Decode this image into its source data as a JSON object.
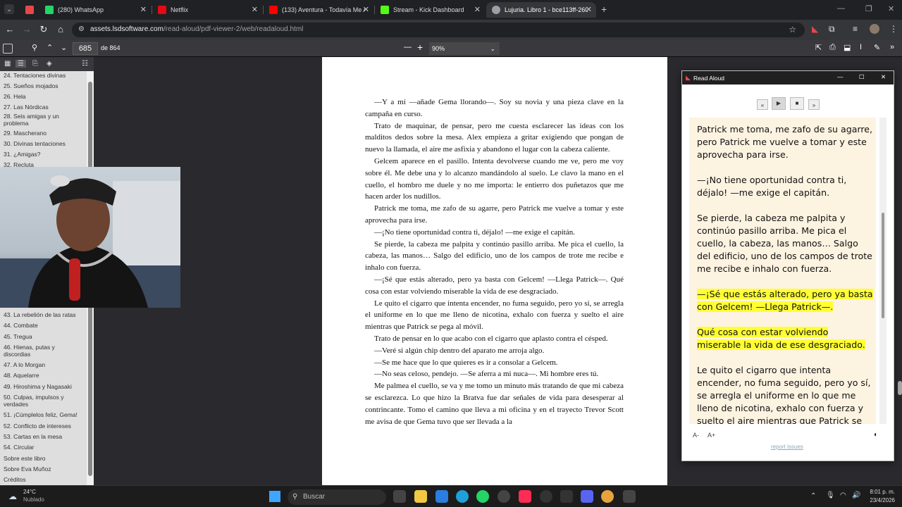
{
  "tabs": [
    {
      "title": "(280) WhatsApp",
      "color": "#25d366"
    },
    {
      "title": "Netflix",
      "color": "#e50914"
    },
    {
      "title": "(133) Aventura - Todavía Me A…",
      "color": "#ff0000"
    },
    {
      "title": "Stream - Kick Dashboard",
      "color": "#53fc18"
    },
    {
      "title": "Lujuria. Libro 1 - bce113ff-2606…",
      "color": "#9aa0a6"
    }
  ],
  "address": {
    "domain": "assets.lsdsoftware.com",
    "path": "/read-aloud/pdf-viewer-2/web/readaloud.html"
  },
  "pdf_toolbar": {
    "page": "685",
    "of": "de 864",
    "zoom": "90%"
  },
  "outline": [
    "24. Tentaciones divinas",
    "25. Sueños mojados",
    "26. Hela",
    "27. Las Nórdicas",
    "28. Seis amigas y un",
    "problema",
    "29. Mascherano",
    "30. Divinas tentaciones",
    "31. ¿Amigas?",
    "32. Recluta",
    "43. La rebelión de las ratas",
    "44. Combate",
    "45. Tregua",
    "46. Hienas, putas y",
    "discordias",
    "47. A lo Morgan",
    "48. Aquelarre",
    "49. Hiroshima y Nagasaki",
    "50. Culpas, impulsos y",
    "verdades",
    "51. ¡Cúmplelos feliz, Gema!",
    "52. Conflicto de intereses",
    "53. Cartas en la mesa",
    "54. Circular",
    "Sobre este libro",
    "Sobre Eva Muñoz",
    "Créditos"
  ],
  "page_paragraphs": [
    "—Y a mí —añade Gema llorando—. Soy su novia y una pieza clave en la campaña en curso.",
    "Trato de maquinar, de pensar, pero me cuesta esclarecer las ideas con los malditos dedos sobre la mesa. Alex empieza a gritar exigiendo que pongan de nuevo la llamada, el aire me asfixia y abandono el lugar con la cabeza caliente.",
    "Gelcem aparece en el pasillo. Intenta devolverse cuando me ve, pero me voy sobre él. Me debe una y lo alcanzo mandándolo al suelo. Le clavo la mano en el cuello, el hombro me duele y no me importa: le entierro dos puñetazos que me hacen arder los nudillos.",
    "Patrick me toma, me zafo de su agarre, pero Patrick me vuelve a tomar y este aprovecha para irse.",
    "—¡No tiene oportunidad contra ti, déjalo! —me exige el capitán.",
    "Se pierde, la cabeza me palpita y continúo pasillo arriba. Me pica el cuello, la cabeza, las manos… Salgo del edificio, uno de los campos de trote me recibe e inhalo con fuerza.",
    "—¡Sé que estás alterado, pero ya basta con Gelcem! —Llega Patrick—. Qué cosa con estar volviendo miserable la vida de ese desgraciado.",
    "Le quito el cigarro que intenta encender, no fuma seguido, pero yo sí, se arregla el uniforme en lo que me lleno de nicotina, exhalo con fuerza y suelto el aire mientras que Patrick se pega al móvil.",
    "Trato de pensar en lo que acabo con el cigarro que aplasto contra el césped.",
    "—Veré si algún chip dentro del aparato me arroja algo.",
    "—Se me hace que lo que quieres es ir a consolar a Gelcem.",
    "—No seas celoso, pendejo. —Se aferra a mi nuca—. Mi hombre eres tú.",
    "Me palmea el cuello, se va y me tomo un minuto más tratando de que mi cabeza se esclarezca. Lo que hizo la Bratva fue dar señales de vida para desesperar al contrincante. Tomo el camino que lleva a mi oficina y en el trayecto Trevor Scott me avisa de que Gema tuvo que ser llevada a la"
  ],
  "read_aloud": {
    "title": "Read Aloud",
    "paragraphs": [
      {
        "text": "Patrick me toma, me zafo de su agarre, pero Patrick me vuelve a tomar y este aprovecha para irse.",
        "hl": false
      },
      {
        "text": "—¡No tiene oportunidad contra ti, déjalo! —me exige el capitán.",
        "hl": false
      },
      {
        "text": "Se pierde, la cabeza me palpita y continúo pasillo arriba. Me pica el cuello, la cabeza, las manos… Salgo del edificio, uno de los campos de trote me recibe e inhalo con fuerza.",
        "hl": false
      },
      {
        "text": "—¡Sé que estás alterado, pero ya basta con Gelcem! —Llega Patrick—.",
        "hl": true
      },
      {
        "text": "Qué cosa con estar volviendo miserable la vida de ese desgraciado.",
        "hl": true
      },
      {
        "text": "Le quito el cigarro que intenta encender, no fuma seguido, pero yo sí, se arregla el uniforme en lo que me lleno de nicotina, exhalo con fuerza y suelto el aire mientras que Patrick se pega al móvil.",
        "hl": false
      }
    ],
    "font_minus": "A-",
    "font_plus": "A+",
    "report": "report issues"
  },
  "taskbar": {
    "temp": "24°C",
    "weather": "Nublado",
    "search": "Buscar",
    "time": "8:01 p. m.",
    "date": "23/4/2026"
  }
}
